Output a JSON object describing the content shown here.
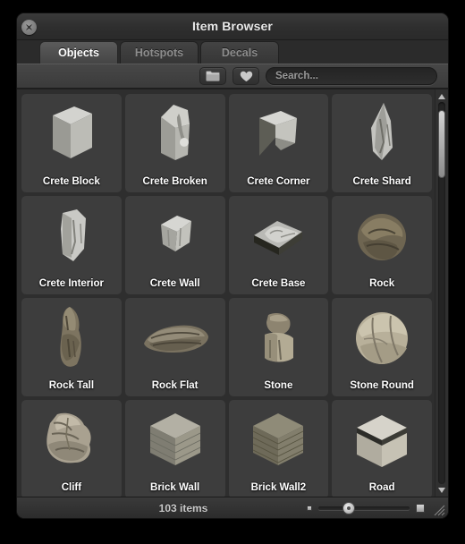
{
  "window": {
    "title": "Item Browser",
    "close_icon": "close-circle-icon"
  },
  "tabs": [
    {
      "label": "Objects",
      "active": true
    },
    {
      "label": "Hotspots",
      "active": false
    },
    {
      "label": "Decals",
      "active": false
    }
  ],
  "toolbar": {
    "folder_icon": "folder-icon",
    "favorites_icon": "heart-icon",
    "search_placeholder": "Search...",
    "search_value": ""
  },
  "grid": {
    "items": [
      {
        "label": "Crete Block",
        "thumb": "concrete-block-cube"
      },
      {
        "label": "Crete Broken",
        "thumb": "broken-concrete-slab"
      },
      {
        "label": "Crete Corner",
        "thumb": "concrete-corner-wedge"
      },
      {
        "label": "Crete Shard",
        "thumb": "concrete-shard-spike"
      },
      {
        "label": "Crete Interior",
        "thumb": "concrete-interior-chunk"
      },
      {
        "label": "Crete Wall",
        "thumb": "concrete-wall-block"
      },
      {
        "label": "Crete Base",
        "thumb": "concrete-base-plate"
      },
      {
        "label": "Rock",
        "thumb": "rock-boulder-round"
      },
      {
        "label": "Rock Tall",
        "thumb": "rock-tall-spire"
      },
      {
        "label": "Rock Flat",
        "thumb": "rock-flat-slab"
      },
      {
        "label": "Stone",
        "thumb": "stone-stacked-block"
      },
      {
        "label": "Stone Round",
        "thumb": "stone-round-sphere"
      },
      {
        "label": "Cliff",
        "thumb": "cliff-rock-face"
      },
      {
        "label": "Brick Wall",
        "thumb": "brick-wall-cube"
      },
      {
        "label": "Brick Wall2",
        "thumb": "brick-wall2-cube"
      },
      {
        "label": "Road",
        "thumb": "road-surface-cube"
      }
    ]
  },
  "scrollbar": {
    "up_icon": "triangle-up-icon",
    "down_icon": "triangle-down-icon",
    "thumb_position_percent": 2,
    "thumb_size_percent": 18
  },
  "statusbar": {
    "item_count": "103 items",
    "zoom_small_icon": "zoom-small-icon",
    "zoom_large_icon": "zoom-large-icon",
    "zoom_value_percent": 33,
    "resize_grip_icon": "resize-grip-icon"
  },
  "colors": {
    "window_bg": "#2b2b2b",
    "cell_bg": "#3d3d3d",
    "grid_bg": "#2e2e2e",
    "text_primary": "#ffffff",
    "text_muted": "#8d8d8d",
    "outer_bg": "#000000"
  }
}
